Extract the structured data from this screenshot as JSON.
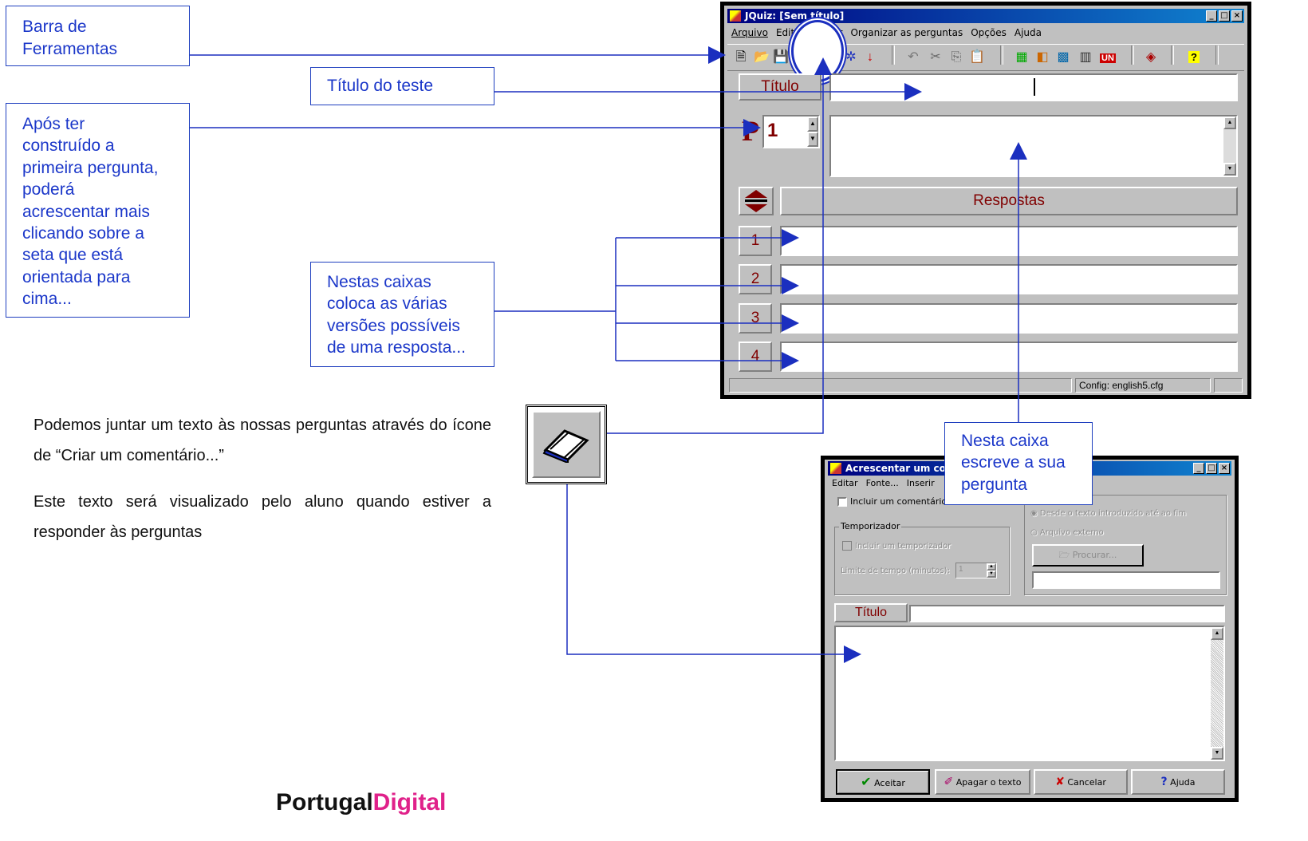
{
  "callouts": {
    "toolbar": [
      "Barra de",
      "Ferramentas"
    ],
    "title": [
      "Título do teste"
    ],
    "after_first": [
      "Após ter",
      "construído a",
      "primeira pergunta,",
      "poderá",
      "acrescentar mais",
      "clicando sobre a",
      "seta que está",
      "orientada para",
      "cima..."
    ],
    "answers": [
      "Nestas caixas",
      "coloca as várias",
      "versões possíveis",
      "de uma resposta..."
    ],
    "question": [
      "Nesta caixa",
      "escreve a sua",
      "pergunta"
    ]
  },
  "paragraphs": {
    "p1": "Podemos juntar um texto às nossas perguntas através do ícone de “Criar um comentário...”",
    "p2": "Este texto será visualizado pelo aluno quando estiver a responder às perguntas"
  },
  "jquiz": {
    "window_title": "JQuiz: [Sem título]",
    "menu": [
      "Arquivo",
      "Editar",
      "Inserir",
      "Organizar as perguntas",
      "Opções",
      "Ajuda"
    ],
    "title_label": "Título",
    "q_letter": "P",
    "q_number": "1",
    "answers_label": "Respostas",
    "answer_numbers": [
      "1",
      "2",
      "3",
      "4"
    ],
    "status_config": "Config: english5.cfg",
    "toolbar_icons": [
      "new-icon",
      "open-icon",
      "save-icon",
      "comment-icon",
      "web-icon",
      "down-arrow-icon",
      "undo-icon",
      "cut-icon",
      "copy-icon",
      "paste-icon",
      "export-icon",
      "web2-icon",
      "tool1-icon",
      "tool2-icon",
      "unicode-icon",
      "help-topics-icon",
      "help-icon"
    ]
  },
  "comment_dialog": {
    "window_title": "Acrescentar um comentário",
    "menu": [
      "Editar",
      "Fonte...",
      "Inserir"
    ],
    "include_comment": "Incluir um comentário",
    "radio_1": "Desde o texto introduzido até ao fim",
    "radio_2": "Arquivo externo",
    "browse": "Procurar...",
    "timer_group": "Temporizador",
    "include_timer": "Incluir um temporizador",
    "time_limit": "Limite de tempo (minutos):",
    "time_value": "1",
    "title_label": "Título",
    "btn_accept": "Aceitar",
    "btn_clear": "Apagar o texto",
    "btn_cancel": "Cancelar",
    "btn_help": "Ajuda"
  },
  "logo": {
    "text_a": "Portugal",
    "text_b": "Digital"
  },
  "colors": {
    "callout_border": "#1f3fbf",
    "callout_text": "#1b37c9",
    "label_text": "#800000",
    "win_face": "#c0c0c0",
    "titlebar": "#000080"
  }
}
